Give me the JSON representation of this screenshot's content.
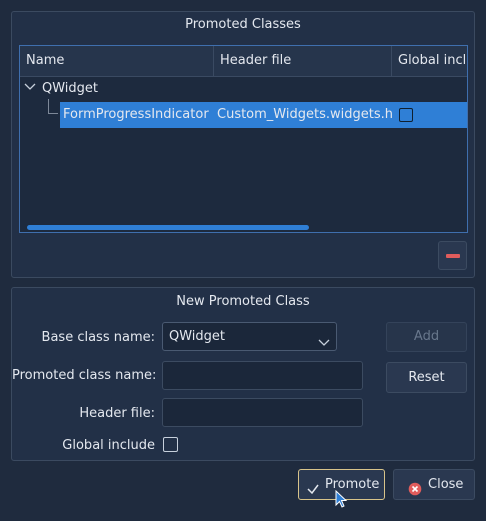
{
  "promoted": {
    "title": "Promoted Classes",
    "columns": [
      "Name",
      "Header file",
      "Global inclu"
    ],
    "tree": {
      "parent": "QWidget",
      "child": {
        "name": "FormProgressIndicator",
        "header": "Custom_Widgets.widgets.h",
        "global_include": false
      }
    },
    "remove_icon": "minus-icon"
  },
  "new_class": {
    "title": "New Promoted Class",
    "base_class_label": "Base class name:",
    "base_class_value": "QWidget",
    "promoted_name_label": "Promoted class name:",
    "promoted_name_value": "",
    "header_file_label": "Header file:",
    "header_file_value": "",
    "global_include_label": "Global include",
    "global_include_checked": false,
    "add_label": "Add",
    "reset_label": "Reset"
  },
  "footer": {
    "promote_label": "Promote",
    "close_label": "Close"
  },
  "colors": {
    "selection": "#2f7fd6",
    "remove_button": "#e05c5c",
    "close_icon": "#e05c5c"
  }
}
